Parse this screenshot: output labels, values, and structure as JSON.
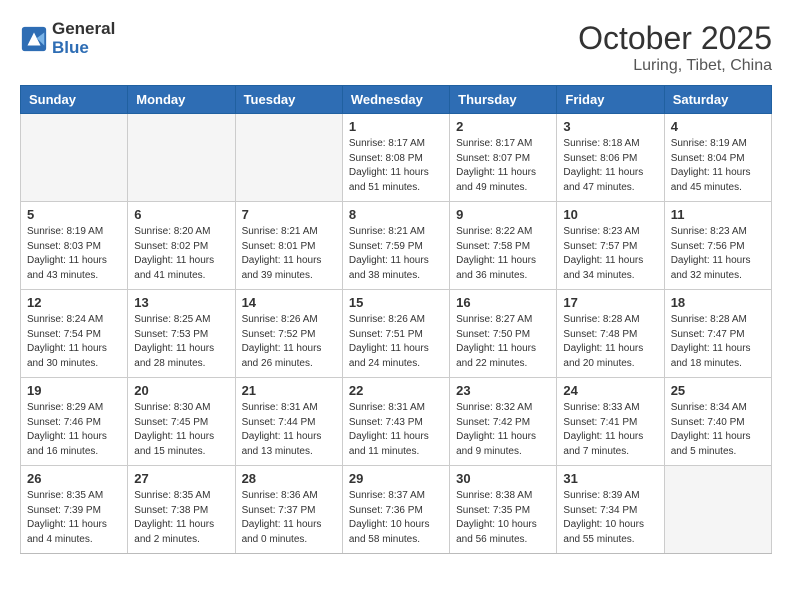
{
  "header": {
    "logo_line1": "General",
    "logo_line2": "Blue",
    "month": "October 2025",
    "location": "Luring, Tibet, China"
  },
  "weekdays": [
    "Sunday",
    "Monday",
    "Tuesday",
    "Wednesday",
    "Thursday",
    "Friday",
    "Saturday"
  ],
  "weeks": [
    [
      {
        "day": "",
        "info": ""
      },
      {
        "day": "",
        "info": ""
      },
      {
        "day": "",
        "info": ""
      },
      {
        "day": "1",
        "info": "Sunrise: 8:17 AM\nSunset: 8:08 PM\nDaylight: 11 hours\nand 51 minutes."
      },
      {
        "day": "2",
        "info": "Sunrise: 8:17 AM\nSunset: 8:07 PM\nDaylight: 11 hours\nand 49 minutes."
      },
      {
        "day": "3",
        "info": "Sunrise: 8:18 AM\nSunset: 8:06 PM\nDaylight: 11 hours\nand 47 minutes."
      },
      {
        "day": "4",
        "info": "Sunrise: 8:19 AM\nSunset: 8:04 PM\nDaylight: 11 hours\nand 45 minutes."
      }
    ],
    [
      {
        "day": "5",
        "info": "Sunrise: 8:19 AM\nSunset: 8:03 PM\nDaylight: 11 hours\nand 43 minutes."
      },
      {
        "day": "6",
        "info": "Sunrise: 8:20 AM\nSunset: 8:02 PM\nDaylight: 11 hours\nand 41 minutes."
      },
      {
        "day": "7",
        "info": "Sunrise: 8:21 AM\nSunset: 8:01 PM\nDaylight: 11 hours\nand 39 minutes."
      },
      {
        "day": "8",
        "info": "Sunrise: 8:21 AM\nSunset: 7:59 PM\nDaylight: 11 hours\nand 38 minutes."
      },
      {
        "day": "9",
        "info": "Sunrise: 8:22 AM\nSunset: 7:58 PM\nDaylight: 11 hours\nand 36 minutes."
      },
      {
        "day": "10",
        "info": "Sunrise: 8:23 AM\nSunset: 7:57 PM\nDaylight: 11 hours\nand 34 minutes."
      },
      {
        "day": "11",
        "info": "Sunrise: 8:23 AM\nSunset: 7:56 PM\nDaylight: 11 hours\nand 32 minutes."
      }
    ],
    [
      {
        "day": "12",
        "info": "Sunrise: 8:24 AM\nSunset: 7:54 PM\nDaylight: 11 hours\nand 30 minutes."
      },
      {
        "day": "13",
        "info": "Sunrise: 8:25 AM\nSunset: 7:53 PM\nDaylight: 11 hours\nand 28 minutes."
      },
      {
        "day": "14",
        "info": "Sunrise: 8:26 AM\nSunset: 7:52 PM\nDaylight: 11 hours\nand 26 minutes."
      },
      {
        "day": "15",
        "info": "Sunrise: 8:26 AM\nSunset: 7:51 PM\nDaylight: 11 hours\nand 24 minutes."
      },
      {
        "day": "16",
        "info": "Sunrise: 8:27 AM\nSunset: 7:50 PM\nDaylight: 11 hours\nand 22 minutes."
      },
      {
        "day": "17",
        "info": "Sunrise: 8:28 AM\nSunset: 7:48 PM\nDaylight: 11 hours\nand 20 minutes."
      },
      {
        "day": "18",
        "info": "Sunrise: 8:28 AM\nSunset: 7:47 PM\nDaylight: 11 hours\nand 18 minutes."
      }
    ],
    [
      {
        "day": "19",
        "info": "Sunrise: 8:29 AM\nSunset: 7:46 PM\nDaylight: 11 hours\nand 16 minutes."
      },
      {
        "day": "20",
        "info": "Sunrise: 8:30 AM\nSunset: 7:45 PM\nDaylight: 11 hours\nand 15 minutes."
      },
      {
        "day": "21",
        "info": "Sunrise: 8:31 AM\nSunset: 7:44 PM\nDaylight: 11 hours\nand 13 minutes."
      },
      {
        "day": "22",
        "info": "Sunrise: 8:31 AM\nSunset: 7:43 PM\nDaylight: 11 hours\nand 11 minutes."
      },
      {
        "day": "23",
        "info": "Sunrise: 8:32 AM\nSunset: 7:42 PM\nDaylight: 11 hours\nand 9 minutes."
      },
      {
        "day": "24",
        "info": "Sunrise: 8:33 AM\nSunset: 7:41 PM\nDaylight: 11 hours\nand 7 minutes."
      },
      {
        "day": "25",
        "info": "Sunrise: 8:34 AM\nSunset: 7:40 PM\nDaylight: 11 hours\nand 5 minutes."
      }
    ],
    [
      {
        "day": "26",
        "info": "Sunrise: 8:35 AM\nSunset: 7:39 PM\nDaylight: 11 hours\nand 4 minutes."
      },
      {
        "day": "27",
        "info": "Sunrise: 8:35 AM\nSunset: 7:38 PM\nDaylight: 11 hours\nand 2 minutes."
      },
      {
        "day": "28",
        "info": "Sunrise: 8:36 AM\nSunset: 7:37 PM\nDaylight: 11 hours\nand 0 minutes."
      },
      {
        "day": "29",
        "info": "Sunrise: 8:37 AM\nSunset: 7:36 PM\nDaylight: 10 hours\nand 58 minutes."
      },
      {
        "day": "30",
        "info": "Sunrise: 8:38 AM\nSunset: 7:35 PM\nDaylight: 10 hours\nand 56 minutes."
      },
      {
        "day": "31",
        "info": "Sunrise: 8:39 AM\nSunset: 7:34 PM\nDaylight: 10 hours\nand 55 minutes."
      },
      {
        "day": "",
        "info": ""
      }
    ]
  ]
}
